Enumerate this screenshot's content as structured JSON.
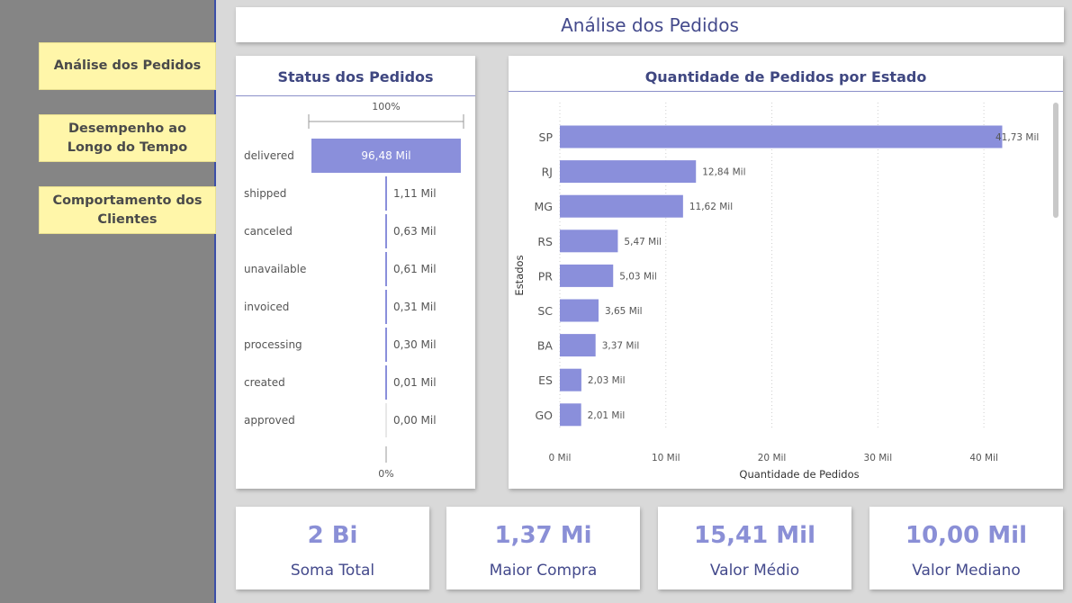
{
  "nav": {
    "items": [
      {
        "label": "Análise dos Pedidos"
      },
      {
        "label": "Desempenho ao Longo do Tempo"
      },
      {
        "label": "Comportamento dos Clientes"
      }
    ]
  },
  "header": {
    "title": "Análise dos Pedidos"
  },
  "status_panel": {
    "title": "Status dos Pedidos",
    "top_label": "100%",
    "bottom_label": "0%"
  },
  "state_panel": {
    "title": "Quantidade de Pedidos por Estado"
  },
  "colors": {
    "bar": "#8a8fdb",
    "nav_bg": "#fff6a9",
    "sidebar_bg": "#858585",
    "accent_text": "#3f4781",
    "kpi_value": "#8a8fd6"
  },
  "chart_data": [
    {
      "type": "bar",
      "title": "Status dos Pedidos",
      "orientation": "horizontal",
      "categories": [
        "delivered",
        "shipped",
        "canceled",
        "unavailable",
        "invoiced",
        "processing",
        "created",
        "approved"
      ],
      "values": [
        96.48,
        1.11,
        0.63,
        0.61,
        0.31,
        0.3,
        0.01,
        0.0
      ],
      "data_labels": [
        "96,48 Mil",
        "1,11 Mil",
        "0,63 Mil",
        "0,61 Mil",
        "0,31 Mil",
        "0,30 Mil",
        "0,01 Mil",
        "0,00 Mil"
      ],
      "value_unit": "Mil",
      "ylim": [
        0,
        100
      ]
    },
    {
      "type": "bar",
      "title": "Quantidade de Pedidos por Estado",
      "orientation": "horizontal",
      "categories": [
        "SP",
        "RJ",
        "MG",
        "RS",
        "PR",
        "SC",
        "BA",
        "ES",
        "GO"
      ],
      "values": [
        41.73,
        12.84,
        11.62,
        5.47,
        5.03,
        3.65,
        3.37,
        2.03,
        2.01
      ],
      "data_labels": [
        "41,73 Mil",
        "12,84 Mil",
        "11,62 Mil",
        "5,47 Mil",
        "5,03 Mil",
        "3,65 Mil",
        "3,37 Mil",
        "2,03 Mil",
        "2,01 Mil"
      ],
      "xlabel": "Quantidade de Pedidos",
      "ylabel": "Estados",
      "xlim": [
        0,
        45
      ],
      "x_ticks": [
        0,
        10,
        20,
        30,
        40
      ],
      "x_tick_labels": [
        "0 Mil",
        "10 Mil",
        "20 Mil",
        "30 Mil",
        "40 Mil"
      ],
      "grid": true
    }
  ],
  "kpis": [
    {
      "value": "2 Bi",
      "label": "Soma Total"
    },
    {
      "value": "1,37 Mi",
      "label": "Maior Compra"
    },
    {
      "value": "15,41 Mil",
      "label": "Valor Médio"
    },
    {
      "value": "10,00 Mil",
      "label": "Valor Mediano"
    }
  ]
}
